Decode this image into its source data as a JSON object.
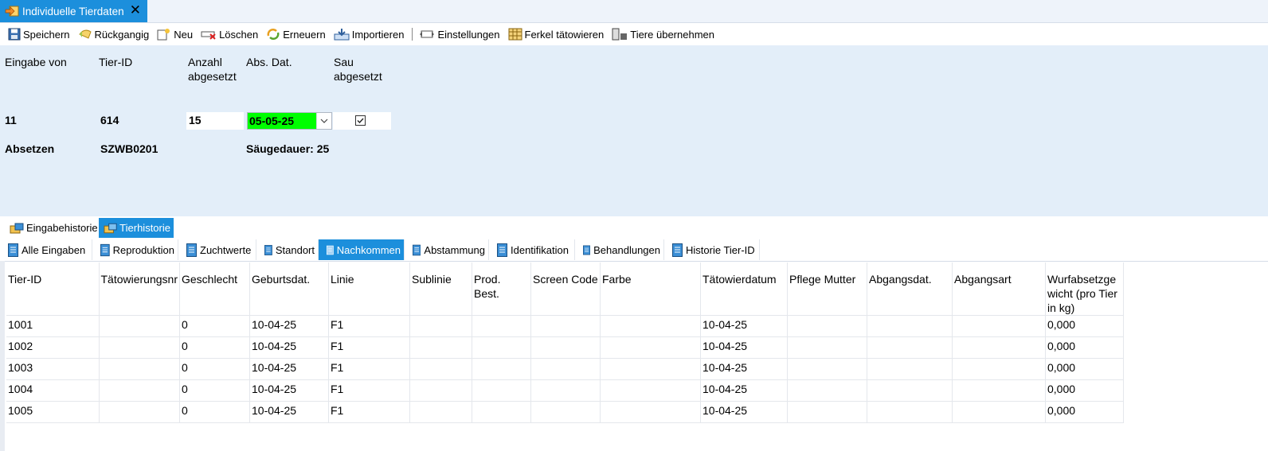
{
  "doc_tab": {
    "title": "Individuelle Tierdaten",
    "close": "✕"
  },
  "toolbar": {
    "save": "Speichern",
    "undo": "Rückgangig",
    "new": "Neu",
    "delete": "Löschen",
    "refresh": "Erneuern",
    "import": "Importieren",
    "settings": "Einstellungen",
    "tattoo": "Ferkel tätowieren",
    "take_over": "Tiere übernehmen"
  },
  "form": {
    "labels": {
      "entry_from": "Eingabe von",
      "animal_id": "Tier-ID",
      "count_weaned_line1": "Anzahl",
      "count_weaned_line2": "abgesetzt",
      "wean_date": "Abs. Dat.",
      "sow_weaned_line1": "Sau",
      "sow_weaned_line2": "abgesetzt"
    },
    "values": {
      "entry_from": "11",
      "animal_id": "614",
      "count_weaned": "15",
      "wean_date": "05-05-25",
      "sow_weaned_checked": true
    },
    "info": {
      "action": "Absetzen",
      "code": "SZWB0201",
      "suckling": "Säugedauer: 25"
    }
  },
  "history_tabs": [
    {
      "label": "Eingabehistorie",
      "active": false
    },
    {
      "label": "Tierhistorie",
      "active": true
    }
  ],
  "sub_tabs": [
    {
      "label": "Alle Eingaben",
      "active": false
    },
    {
      "label": "Reproduktion",
      "active": false
    },
    {
      "label": "Zuchtwerte",
      "active": false
    },
    {
      "label": "Standort",
      "active": false
    },
    {
      "label": "Nachkommen",
      "active": true
    },
    {
      "label": "Abstammung",
      "active": false
    },
    {
      "label": "Identifikation",
      "active": false
    },
    {
      "label": "Behandlungen",
      "active": false
    },
    {
      "label": "Historie Tier-ID",
      "active": false
    }
  ],
  "table": {
    "columns": [
      "Tier-ID",
      "Tätowierungsnr",
      "Geschlecht",
      "Geburtsdat.",
      "Linie",
      "Sublinie",
      "Prod. Best.",
      "Screen Code",
      "Farbe",
      "Tätowierdatum",
      "Pflege Mutter",
      "Abgangsdat.",
      "Abgangsart",
      "Wurfabsetzgewicht (pro Tier in kg)"
    ],
    "rows": [
      [
        "1001",
        "",
        "0",
        "10-04-25",
        "F1",
        "",
        "",
        "",
        "",
        "10-04-25",
        "",
        "",
        "",
        "0,000"
      ],
      [
        "1002",
        "",
        "0",
        "10-04-25",
        "F1",
        "",
        "",
        "",
        "",
        "10-04-25",
        "",
        "",
        "",
        "0,000"
      ],
      [
        "1003",
        "",
        "0",
        "10-04-25",
        "F1",
        "",
        "",
        "",
        "",
        "10-04-25",
        "",
        "",
        "",
        "0,000"
      ],
      [
        "1004",
        "",
        "0",
        "10-04-25",
        "F1",
        "",
        "",
        "",
        "",
        "10-04-25",
        "",
        "",
        "",
        "0,000"
      ],
      [
        "1005",
        "",
        "0",
        "10-04-25",
        "F1",
        "",
        "",
        "",
        "",
        "10-04-25",
        "",
        "",
        "",
        "0,000"
      ]
    ]
  },
  "colors": {
    "accent": "#1c8fdc",
    "panel": "#e3eef9",
    "date_highlight": "#00ff00"
  }
}
